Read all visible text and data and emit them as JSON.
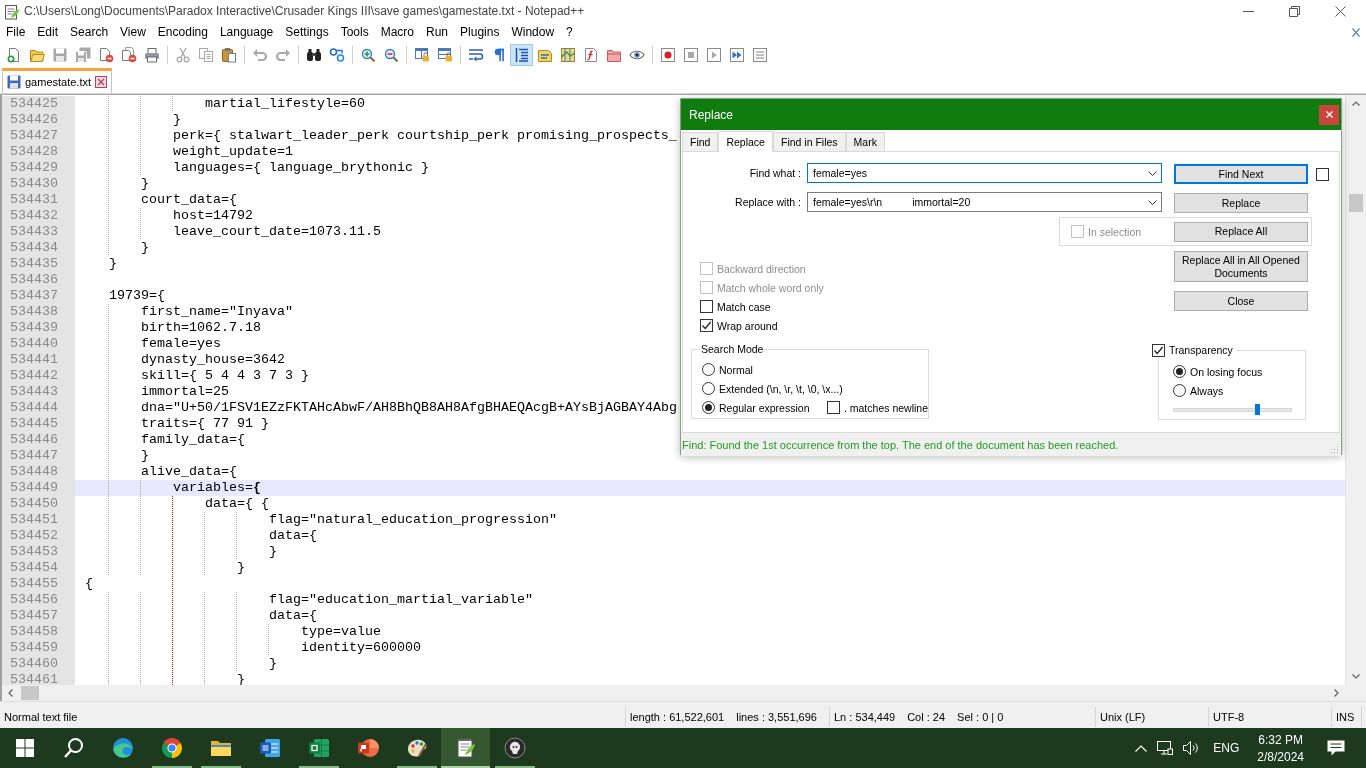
{
  "window": {
    "title": "C:\\Users\\Long\\Documents\\Paradox Interactive\\Crusader Kings III\\save games\\gamestate.txt - Notepad++"
  },
  "menu": [
    "File",
    "Edit",
    "Search",
    "View",
    "Encoding",
    "Language",
    "Settings",
    "Tools",
    "Macro",
    "Run",
    "Plugins",
    "Window",
    "?"
  ],
  "toolbar": [
    [
      {
        "kind": "new",
        "disabled": false,
        "pressed": false
      },
      {
        "kind": "open",
        "disabled": false,
        "pressed": false
      },
      {
        "kind": "save",
        "disabled": true,
        "pressed": false
      },
      {
        "kind": "saveall",
        "disabled": true,
        "pressed": false
      },
      {
        "kind": "close",
        "disabled": false,
        "pressed": false
      },
      {
        "kind": "closeall",
        "disabled": false,
        "pressed": false
      },
      {
        "kind": "print",
        "disabled": false,
        "pressed": false
      }
    ],
    [
      {
        "kind": "cut",
        "disabled": true,
        "pressed": false
      },
      {
        "kind": "copy",
        "disabled": true,
        "pressed": false
      },
      {
        "kind": "paste",
        "disabled": false,
        "pressed": false
      }
    ],
    [
      {
        "kind": "undo",
        "disabled": true,
        "pressed": false
      },
      {
        "kind": "redo",
        "disabled": true,
        "pressed": false
      }
    ],
    [
      {
        "kind": "find",
        "disabled": false,
        "pressed": false
      },
      {
        "kind": "replace",
        "disabled": false,
        "pressed": false
      }
    ],
    [
      {
        "kind": "zoomin",
        "disabled": false,
        "pressed": false
      },
      {
        "kind": "zoomout",
        "disabled": false,
        "pressed": false
      }
    ],
    [
      {
        "kind": "syncv",
        "disabled": false,
        "pressed": false
      },
      {
        "kind": "synch",
        "disabled": false,
        "pressed": false
      }
    ],
    [
      {
        "kind": "wrap",
        "disabled": false,
        "pressed": false
      },
      {
        "kind": "allchars",
        "disabled": false,
        "pressed": false
      },
      {
        "kind": "indentguide",
        "disabled": false,
        "pressed": true
      },
      {
        "kind": "udl",
        "disabled": false,
        "pressed": false
      },
      {
        "kind": "docmap",
        "disabled": false,
        "pressed": false
      },
      {
        "kind": "funclist",
        "disabled": false,
        "pressed": false
      },
      {
        "kind": "folder",
        "disabled": false,
        "pressed": false
      },
      {
        "kind": "monitor",
        "disabled": false,
        "pressed": false
      }
    ],
    [
      {
        "kind": "record",
        "disabled": false,
        "pressed": false
      },
      {
        "kind": "stop",
        "disabled": true,
        "pressed": false
      },
      {
        "kind": "play",
        "disabled": true,
        "pressed": false
      },
      {
        "kind": "playmulti",
        "disabled": false,
        "pressed": false
      },
      {
        "kind": "savemacro",
        "disabled": true,
        "pressed": false
      }
    ]
  ],
  "tabs": [
    {
      "label": "gamestate.txt",
      "selected": true,
      "modified": false
    }
  ],
  "editor": {
    "lines": [
      {
        "number": "534425",
        "text": "\t\t\t\tmartial_lifestyle=60",
        "current": false,
        "brace_block": false
      },
      {
        "number": "534426",
        "text": "\t\t\t}",
        "current": false,
        "brace_block": false
      },
      {
        "number": "534427",
        "text": "\t\t\tperk={ stalwart_leader_perk courtship_perk promising_prospects_",
        "current": false,
        "brace_block": false
      },
      {
        "number": "534428",
        "text": "\t\t\tweight_update=1",
        "current": false,
        "brace_block": false
      },
      {
        "number": "534429",
        "text": "\t\t\tlanguages={ language_brythonic }",
        "current": false,
        "brace_block": false
      },
      {
        "number": "534430",
        "text": "\t\t}",
        "current": false,
        "brace_block": false
      },
      {
        "number": "534431",
        "text": "\t\tcourt_data={",
        "current": false,
        "brace_block": false
      },
      {
        "number": "534432",
        "text": "\t\t\thost=14792",
        "current": false,
        "brace_block": false
      },
      {
        "number": "534433",
        "text": "\t\t\tleave_court_date=1073.11.5",
        "current": false,
        "brace_block": false
      },
      {
        "number": "534434",
        "text": "\t\t}",
        "current": false,
        "brace_block": false
      },
      {
        "number": "534435",
        "text": "\t}",
        "current": false,
        "brace_block": false
      },
      {
        "number": "534436",
        "current": false,
        "brace_block": false
      },
      {
        "number": "534437",
        "text": "\t19739={",
        "current": false,
        "brace_block": false
      },
      {
        "number": "534438",
        "text": "\t\tfirst_name=\"Inyava\"",
        "current": false,
        "brace_block": false
      },
      {
        "number": "534439",
        "text": "\t\tbirth=1062.7.18",
        "current": false,
        "brace_block": false
      },
      {
        "number": "534440",
        "text": "\t\tfemale=yes",
        "current": false,
        "brace_block": false
      },
      {
        "number": "534441",
        "text": "\t\tdynasty_house=3642",
        "current": false,
        "brace_block": false
      },
      {
        "number": "534442",
        "text": "\t\tskill={ 5 4 4 3 7 3 }",
        "current": false,
        "brace_block": false
      },
      {
        "number": "534443",
        "text": "\t\timmortal=25",
        "current": false,
        "brace_block": false
      },
      {
        "number": "534444",
        "text": "\t\tdna=\"U+50/1FSV1EZzFKTAHcAbwF/AH8BhQB8AH8AfgBHAEQAcgB+AYsBjAGBAY4Abg",
        "current": false,
        "brace_block": false
      },
      {
        "number": "534445",
        "text": "\t\ttraits={ 77 91 }",
        "current": false,
        "brace_block": false
      },
      {
        "number": "534446",
        "text": "\t\tfamily_data={",
        "current": false,
        "brace_block": false
      },
      {
        "number": "534447",
        "text": "\t\t}",
        "current": false,
        "brace_block": false
      },
      {
        "number": "534448",
        "text": "\t\talive_data={",
        "current": false,
        "brace_block": false
      },
      {
        "number": "534449",
        "text": "\t\t\tvariables=**{**",
        "current": true,
        "brace_block": false
      },
      {
        "number": "534450",
        "text": "\t\t\t\tdata={ {",
        "current": false,
        "brace_block": true
      },
      {
        "number": "534451",
        "text": "\t\t\t\t\t\tflag=\"natural_education_progression\"",
        "current": false,
        "brace_block": true
      },
      {
        "number": "534452",
        "text": "\t\t\t\t\t\tdata={",
        "current": false,
        "brace_block": true
      },
      {
        "number": "534453",
        "text": "\t\t\t\t\t\t}",
        "current": false,
        "brace_block": true
      },
      {
        "number": "534454",
        "text": "\t\t\t\t\t}",
        "current": false,
        "brace_block": true
      },
      {
        "number": "534455",
        "text": " {",
        "current": false,
        "brace_block": true
      },
      {
        "number": "534456",
        "text": "\t\t\t\t\t\tflag=\"education_martial_variable\"",
        "current": false,
        "brace_block": true
      },
      {
        "number": "534457",
        "text": "\t\t\t\t\t\tdata={",
        "current": false,
        "brace_block": true
      },
      {
        "number": "534458",
        "text": "\t\t\t\t\t\t\ttype=value",
        "current": false,
        "brace_block": true
      },
      {
        "number": "534459",
        "text": "\t\t\t\t\t\t\tidentity=600000",
        "current": false,
        "brace_block": true
      },
      {
        "number": "534460",
        "text": "\t\t\t\t\t\t}",
        "current": false,
        "brace_block": true
      },
      {
        "number": "534461",
        "text": "\t\t\t\t\t}",
        "current": false,
        "brace_block": true
      }
    ]
  },
  "replace_dialog": {
    "title": "Replace",
    "tabs": [
      {
        "label": "Find",
        "selected": false
      },
      {
        "label": "Replace",
        "selected": true
      },
      {
        "label": "Find in Files",
        "selected": false
      },
      {
        "label": "Mark",
        "selected": false
      }
    ],
    "fields": [
      {
        "label": "Find what :",
        "value": "female=yes",
        "focused": true
      },
      {
        "label": "Replace with :",
        "value": "female=yes\\r\\n\timmortal=20",
        "focused": false
      }
    ],
    "buttons": [
      {
        "label": "Find Next",
        "default": true
      },
      {
        "label": "Replace",
        "default": false
      },
      {
        "label": "Replace All",
        "default": false
      },
      {
        "label": "Replace All in All Opened Documents",
        "default": false
      },
      {
        "label": "Close",
        "default": false
      }
    ],
    "find_next_checkbox": {
      "checked": false
    },
    "in_selection": {
      "label": "In selection",
      "checked": false,
      "disabled": true
    },
    "options": [
      {
        "label": "Backward direction",
        "checked": false,
        "disabled": true
      },
      {
        "label": "Match whole word only",
        "checked": false,
        "disabled": true
      },
      {
        "label": "Match case",
        "checked": false,
        "disabled": false
      },
      {
        "label": "Wrap around",
        "checked": true,
        "disabled": false
      }
    ],
    "search_mode": {
      "title": "Search Mode",
      "modes": [
        {
          "label": "Normal",
          "selected": false
        },
        {
          "label": "Extended (\\n, \\r, \\t, \\0, \\x...)",
          "selected": false
        },
        {
          "label": "Regular expression",
          "selected": true
        }
      ],
      "dot_newline": {
        "label": ". matches newline",
        "checked": false
      }
    },
    "transparency": {
      "label": "Transparency",
      "checked": true,
      "modes": [
        {
          "label": "On losing focus",
          "selected": true
        },
        {
          "label": "Always",
          "selected": false
        }
      ],
      "level": 0.71
    },
    "message": "Find: Found the 1st occurrence from the top. The end of the document has been reached."
  },
  "status_bar": [
    {
      "texts": [
        "Normal text file"
      ]
    },
    {
      "texts": [
        "length : 61,522,601",
        "lines : 3,551,696"
      ]
    },
    {
      "texts": [
        "Ln : 534,449",
        "Col : 24",
        "Sel : 0 | 0"
      ]
    },
    {
      "texts": [
        "Unix (LF)"
      ]
    },
    {
      "texts": [
        "UTF-8"
      ]
    },
    {
      "texts": [
        "INS"
      ]
    }
  ],
  "taskbar": {
    "apps": [
      {
        "kind": "start",
        "running": false,
        "active": false
      },
      {
        "kind": "search",
        "running": false,
        "active": false
      },
      {
        "kind": "edge",
        "running": false,
        "active": false
      },
      {
        "kind": "chrome",
        "running": true,
        "active": false
      },
      {
        "kind": "explorer",
        "running": true,
        "active": false
      },
      {
        "kind": "word",
        "running": false,
        "active": false
      },
      {
        "kind": "excel",
        "running": true,
        "active": false
      },
      {
        "kind": "powerpoint",
        "running": false,
        "active": false
      },
      {
        "kind": "paint",
        "running": true,
        "active": false
      },
      {
        "kind": "notepad",
        "running": true,
        "active": true
      },
      {
        "kind": "badge",
        "running": true,
        "active": false
      }
    ],
    "tray": {
      "language": "ENG",
      "time": "6:32 PM",
      "date": "2/8/2024"
    }
  }
}
